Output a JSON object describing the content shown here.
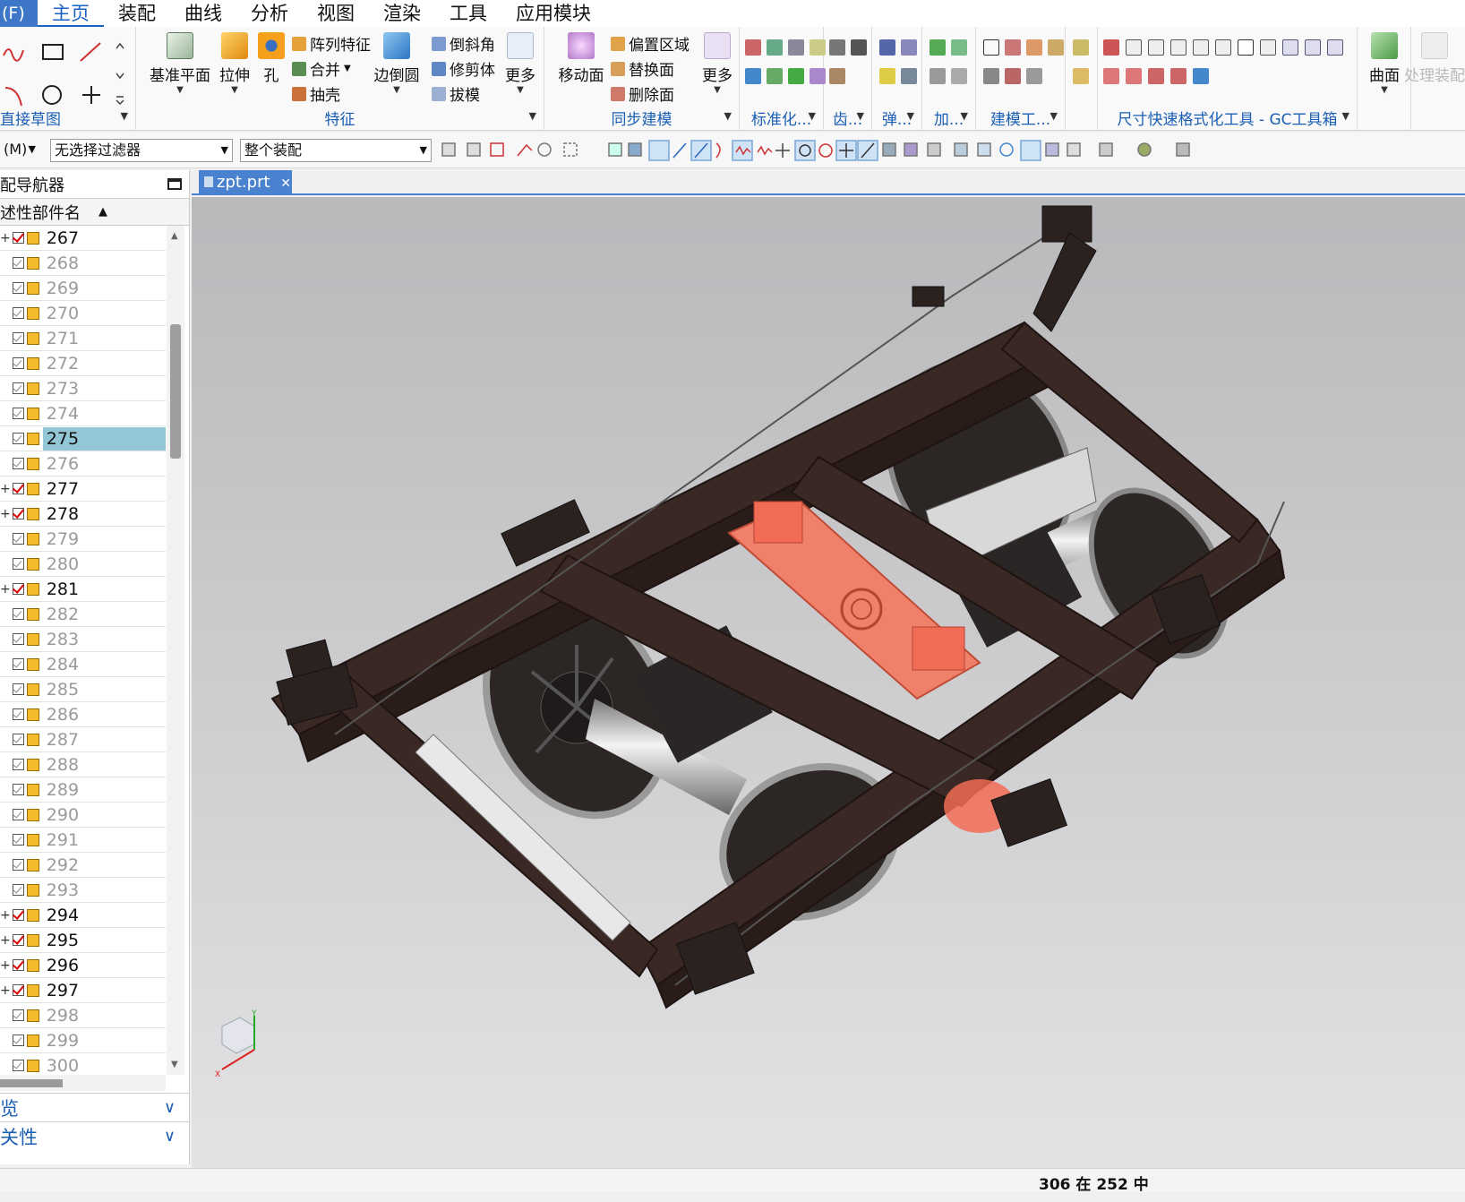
{
  "menubar": {
    "file": "(F)",
    "items": [
      "主页",
      "装配",
      "曲线",
      "分析",
      "视图",
      "渲染",
      "工具",
      "应用模块"
    ]
  },
  "ribbon": {
    "direct_sketch": {
      "label": "直接草图"
    },
    "features": {
      "label": "特征",
      "datum_plane": "基准平面",
      "extrude": "拉伸",
      "hole": "孔",
      "pattern": "阵列特征",
      "unite": "合并",
      "shell": "抽壳",
      "edge_blend": "边倒圆",
      "chamfer": "倒斜角",
      "trim_body": "修剪体",
      "draft": "拔模",
      "more": "更多"
    },
    "sync": {
      "label": "同步建模",
      "move_face": "移动面",
      "offset_region": "偏置区域",
      "replace_face": "替换面",
      "delete_face": "删除面",
      "more": "更多"
    },
    "short_groups": [
      "标准化...",
      "齿...",
      "弹...",
      "加...",
      "建模工..."
    ],
    "gc_label": "尺寸快速格式化工具 - GC工具箱",
    "surface": "曲面",
    "process_assembly": "处理装配"
  },
  "toolbar2": {
    "menu": "(M)",
    "filter": "无选择过滤器",
    "scope": "整个装配"
  },
  "navigator": {
    "title": "配导航器",
    "column": "述性部件名",
    "rows": [
      {
        "label": "267",
        "expand": true,
        "checked": true,
        "dim": false,
        "selected": false
      },
      {
        "label": "268",
        "expand": false,
        "checked": false,
        "dim": true,
        "selected": false
      },
      {
        "label": "269",
        "expand": false,
        "checked": false,
        "dim": true,
        "selected": false
      },
      {
        "label": "270",
        "expand": false,
        "checked": false,
        "dim": true,
        "selected": false
      },
      {
        "label": "271",
        "expand": false,
        "checked": false,
        "dim": true,
        "selected": false
      },
      {
        "label": "272",
        "expand": false,
        "checked": false,
        "dim": true,
        "selected": false
      },
      {
        "label": "273",
        "expand": false,
        "checked": false,
        "dim": true,
        "selected": false
      },
      {
        "label": "274",
        "expand": false,
        "checked": false,
        "dim": true,
        "selected": false
      },
      {
        "label": "275",
        "expand": false,
        "checked": false,
        "dim": false,
        "selected": true
      },
      {
        "label": "276",
        "expand": false,
        "checked": false,
        "dim": true,
        "selected": false
      },
      {
        "label": "277",
        "expand": true,
        "checked": true,
        "dim": false,
        "selected": false
      },
      {
        "label": "278",
        "expand": true,
        "checked": true,
        "dim": false,
        "selected": false
      },
      {
        "label": "279",
        "expand": false,
        "checked": false,
        "dim": true,
        "selected": false
      },
      {
        "label": "280",
        "expand": false,
        "checked": false,
        "dim": true,
        "selected": false
      },
      {
        "label": "281",
        "expand": true,
        "checked": true,
        "dim": false,
        "selected": false
      },
      {
        "label": "282",
        "expand": false,
        "checked": false,
        "dim": true,
        "selected": false
      },
      {
        "label": "283",
        "expand": false,
        "checked": false,
        "dim": true,
        "selected": false
      },
      {
        "label": "284",
        "expand": false,
        "checked": false,
        "dim": true,
        "selected": false
      },
      {
        "label": "285",
        "expand": false,
        "checked": false,
        "dim": true,
        "selected": false
      },
      {
        "label": "286",
        "expand": false,
        "checked": false,
        "dim": true,
        "selected": false
      },
      {
        "label": "287",
        "expand": false,
        "checked": false,
        "dim": true,
        "selected": false
      },
      {
        "label": "288",
        "expand": false,
        "checked": false,
        "dim": true,
        "selected": false
      },
      {
        "label": "289",
        "expand": false,
        "checked": false,
        "dim": true,
        "selected": false
      },
      {
        "label": "290",
        "expand": false,
        "checked": false,
        "dim": true,
        "selected": false
      },
      {
        "label": "291",
        "expand": false,
        "checked": false,
        "dim": true,
        "selected": false
      },
      {
        "label": "292",
        "expand": false,
        "checked": false,
        "dim": true,
        "selected": false
      },
      {
        "label": "293",
        "expand": false,
        "checked": false,
        "dim": true,
        "selected": false
      },
      {
        "label": "294",
        "expand": true,
        "checked": true,
        "dim": false,
        "selected": false
      },
      {
        "label": "295",
        "expand": true,
        "checked": true,
        "dim": false,
        "selected": false
      },
      {
        "label": "296",
        "expand": true,
        "checked": true,
        "dim": false,
        "selected": false
      },
      {
        "label": "297",
        "expand": true,
        "checked": true,
        "dim": false,
        "selected": false
      },
      {
        "label": "298",
        "expand": false,
        "checked": false,
        "dim": true,
        "selected": false
      },
      {
        "label": "299",
        "expand": false,
        "checked": false,
        "dim": true,
        "selected": false
      },
      {
        "label": "300",
        "expand": false,
        "checked": false,
        "dim": true,
        "selected": false
      }
    ],
    "preview_label": "览",
    "dependency_label": "关性"
  },
  "document": {
    "tab": "zpt.prt"
  },
  "status": {
    "text": "306 在 252 中"
  },
  "colors": {
    "accent": "#1a62c4",
    "frame": "#3a2824",
    "highlight": "#f0806a",
    "selection": "#93c7d6"
  },
  "icons": {
    "tab_close": "close-icon",
    "nav_maximize": "maximize-icon",
    "triad": "wcs-triad-icon"
  }
}
